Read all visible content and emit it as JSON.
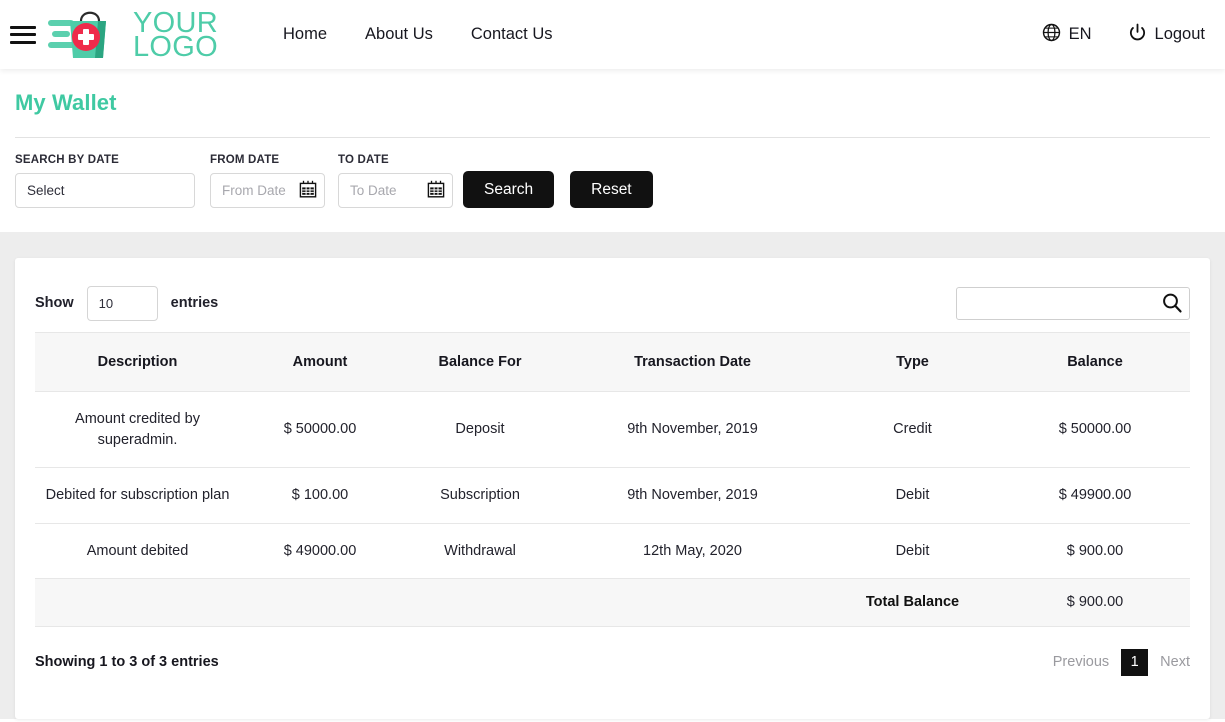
{
  "theme": {
    "accent": "#3FC9A2",
    "logo_green": "#4ECCA8",
    "dark": "#111111",
    "gray_bg": "#ededed",
    "row_alt": "#f7f7f7"
  },
  "header": {
    "menu_icon": "hamburger-icon",
    "logo": {
      "line1": "YOUR",
      "line2": "LOGO",
      "mark": "medical-shopping-bag-icon"
    },
    "nav": [
      {
        "label": "Home"
      },
      {
        "label": "About Us"
      },
      {
        "label": "Contact Us"
      }
    ],
    "language": {
      "icon": "globe-icon",
      "label": "EN"
    },
    "logout": {
      "icon": "power-icon",
      "label": "Logout"
    }
  },
  "page": {
    "title": "My Wallet"
  },
  "filters": {
    "search_by_date": {
      "label": "SEARCH BY DATE",
      "value": "Select"
    },
    "from_date": {
      "label": "FROM DATE",
      "placeholder": "From Date",
      "value": "",
      "icon": "calendar-icon"
    },
    "to_date": {
      "label": "TO DATE",
      "placeholder": "To Date",
      "value": "",
      "icon": "calendar-icon"
    },
    "search_button": "Search",
    "reset_button": "Reset"
  },
  "table_controls": {
    "show_label": "Show",
    "entries_value": "10",
    "entries_label": "entries",
    "search_placeholder": "",
    "search_value": "",
    "search_icon": "search-icon"
  },
  "table": {
    "columns": [
      "Description",
      "Amount",
      "Balance For",
      "Transaction Date",
      "Type",
      "Balance"
    ],
    "rows": [
      {
        "description": "Amount credited by superadmin.",
        "amount": "$ 50000.00",
        "balance_for": "Deposit",
        "transaction_date": "9th November, 2019",
        "type": "Credit",
        "balance": "$ 50000.00"
      },
      {
        "description": "Debited for subscription plan",
        "amount": "$ 100.00",
        "balance_for": "Subscription",
        "transaction_date": "9th November, 2019",
        "type": "Debit",
        "balance": "$ 49900.00"
      },
      {
        "description": "Amount debited",
        "amount": "$ 49000.00",
        "balance_for": "Withdrawal",
        "transaction_date": "12th May, 2020",
        "type": "Debit",
        "balance": "$ 900.00"
      }
    ],
    "total": {
      "label": "Total Balance",
      "value": "$ 900.00"
    }
  },
  "footer": {
    "showing": "Showing 1 to 3 of 3 entries",
    "previous": "Previous",
    "current_page": "1",
    "next": "Next"
  }
}
